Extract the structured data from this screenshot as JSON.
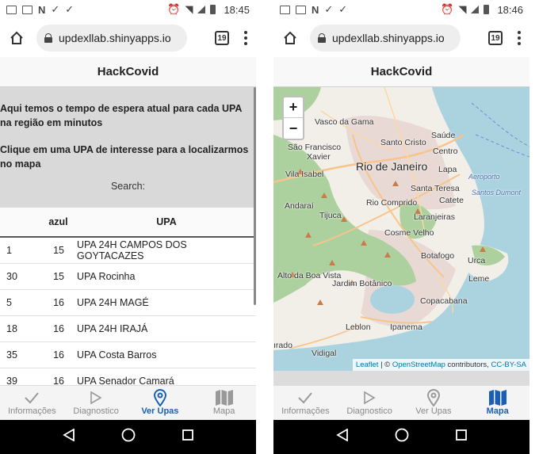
{
  "status": {
    "left_time": "18:45",
    "right_time": "18:46"
  },
  "browser": {
    "url": "updexllab.shinyapps.io",
    "tab_count": "19"
  },
  "app": {
    "title": "HackCovid"
  },
  "upas_page": {
    "intro_text": "Aqui temos o tempo de espera atual para cada UPA na região em minutos",
    "instruction_text": "Clique em uma UPA de interesse para a localizarmos no mapa",
    "search_label": "Search:",
    "columns": [
      "",
      "azul",
      "UPA"
    ],
    "rows": [
      {
        "id": "1",
        "azul": "15",
        "upa": "UPA 24H CAMPOS DOS GOYTACAZES"
      },
      {
        "id": "30",
        "azul": "15",
        "upa": "UPA Rocinha"
      },
      {
        "id": "5",
        "azul": "16",
        "upa": "UPA 24H MAGÉ"
      },
      {
        "id": "18",
        "azul": "16",
        "upa": "UPA 24H IRAJÁ"
      },
      {
        "id": "35",
        "azul": "16",
        "upa": "UPA Costa Barros"
      },
      {
        "id": "39",
        "azul": "16",
        "upa": "UPA Senador Camará"
      }
    ]
  },
  "nav": {
    "informacoes": "Informações",
    "diagnostico": "Diagnostico",
    "ver_upas": "Ver Upas",
    "mapa": "Mapa"
  },
  "map": {
    "zoom_in": "+",
    "zoom_out": "−",
    "attribution_leaflet": "Leaflet",
    "attribution_sep": " | © ",
    "attribution_osm": "OpenStreetMap",
    "attribution_contrib": " contributors, ",
    "attribution_license": "CC-BY-SA",
    "labels": {
      "vasco": "Vasco da Gama",
      "santo_cristo": "Santo Cristo",
      "saude": "Saúde",
      "sao_francisco": "São Francisco",
      "xavier": "Xavier",
      "centro": "Centro",
      "rio": "Rio de Janeiro",
      "vila_isabel": "Vila Isabel",
      "lapa": "Lapa",
      "aeroporto": "Aeroporto",
      "santos_dumont": "Santos Dumont",
      "santa_teresa": "Santa Teresa",
      "andarai": "Andaraí",
      "rio_comprido": "Rio Comprido",
      "catete": "Catete",
      "tijuca": "Tijuca",
      "laranjeiras": "Laranjeiras",
      "cosme_velho": "Cosme Velho",
      "botafogo": "Botafogo",
      "urca": "Urca",
      "alto_boa_vista": "Alto da Boa Vista",
      "jardim_botanico": "Jardim Botânico",
      "leme": "Leme",
      "copacabana": "Copacabana",
      "leblon": "Leblon",
      "ipanema": "Ipanema",
      "gavea_frag": "ırado",
      "vidigal": "Vidigal"
    }
  },
  "colors": {
    "accent": "#1a5fb4",
    "gray_panel": "#d9d9d9",
    "water": "#aad3df",
    "park": "#8fd08f"
  }
}
